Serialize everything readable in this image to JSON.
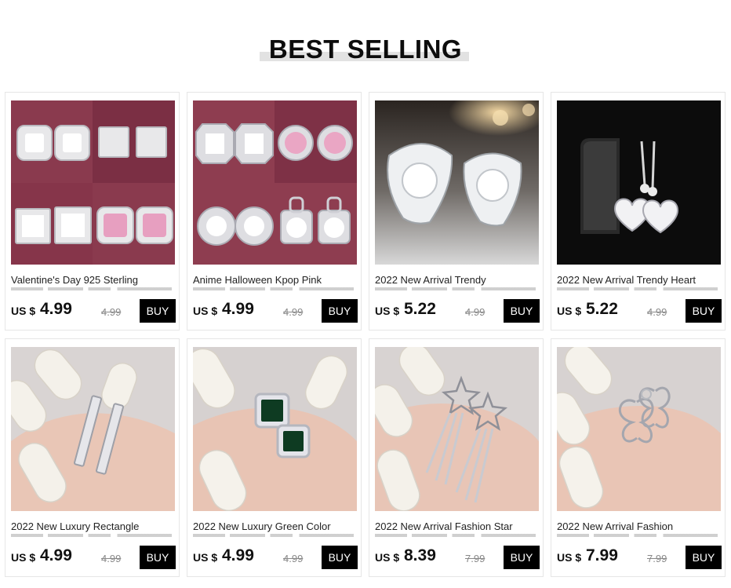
{
  "section": {
    "title": "BEST SELLING"
  },
  "products": [
    {
      "name": "Valentine's Day 925  Sterling",
      "currency": "US $",
      "price": "4.99",
      "old_price": "4.99",
      "buy": "BUY",
      "image_icon": "earrings-square-image"
    },
    {
      "name": "Anime Halloween Kpop Pink",
      "currency": "US $",
      "price": "4.99",
      "old_price": "4.99",
      "buy": "BUY",
      "image_icon": "earrings-halo-image"
    },
    {
      "name": "2022 New Arrival Trendy",
      "currency": "US $",
      "price": "5.22",
      "old_price": "4.99",
      "buy": "BUY",
      "image_icon": "earrings-triangle-image"
    },
    {
      "name": "2022 New Arrival Trendy Heart",
      "currency": "US $",
      "price": "5.22",
      "old_price": "4.99",
      "buy": "BUY",
      "image_icon": "earrings-heart-drop-image"
    },
    {
      "name": "2022 New Luxury Rectangle",
      "currency": "US $",
      "price": "4.99",
      "old_price": "4.99",
      "buy": "BUY",
      "image_icon": "ring-rectangle-image"
    },
    {
      "name": "2022 New Luxury Green Color",
      "currency": "US $",
      "price": "4.99",
      "old_price": "4.99",
      "buy": "BUY",
      "image_icon": "ring-green-image"
    },
    {
      "name": "2022 New Arrival Fashion Star",
      "currency": "US $",
      "price": "8.39",
      "old_price": "7.99",
      "buy": "BUY",
      "image_icon": "earrings-star-image"
    },
    {
      "name": "2022 New Arrival Fashion",
      "currency": "US $",
      "price": "7.99",
      "old_price": "7.99",
      "buy": "BUY",
      "image_icon": "earrings-butterfly-image"
    }
  ]
}
